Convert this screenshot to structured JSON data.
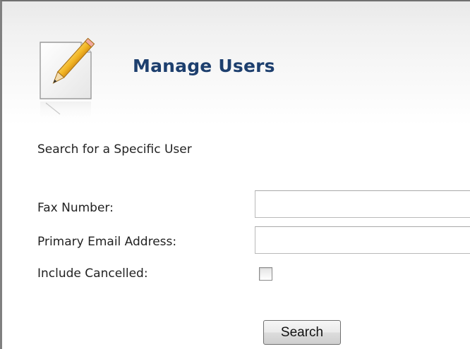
{
  "header": {
    "title": "Manage Users",
    "icon": "pencil-notepad-icon"
  },
  "search": {
    "heading": "Search for a Specific User",
    "fields": [
      {
        "label": "Fax Number:",
        "value": "",
        "placeholder": ""
      },
      {
        "label": "Primary Email Address:",
        "value": "",
        "placeholder": ""
      }
    ],
    "include_cancelled": {
      "label": "Include Cancelled:",
      "checked": false
    },
    "button_label": "Search"
  },
  "colors": {
    "title": "#1d3f6e",
    "text": "#222222",
    "frame_border": "#808080"
  }
}
